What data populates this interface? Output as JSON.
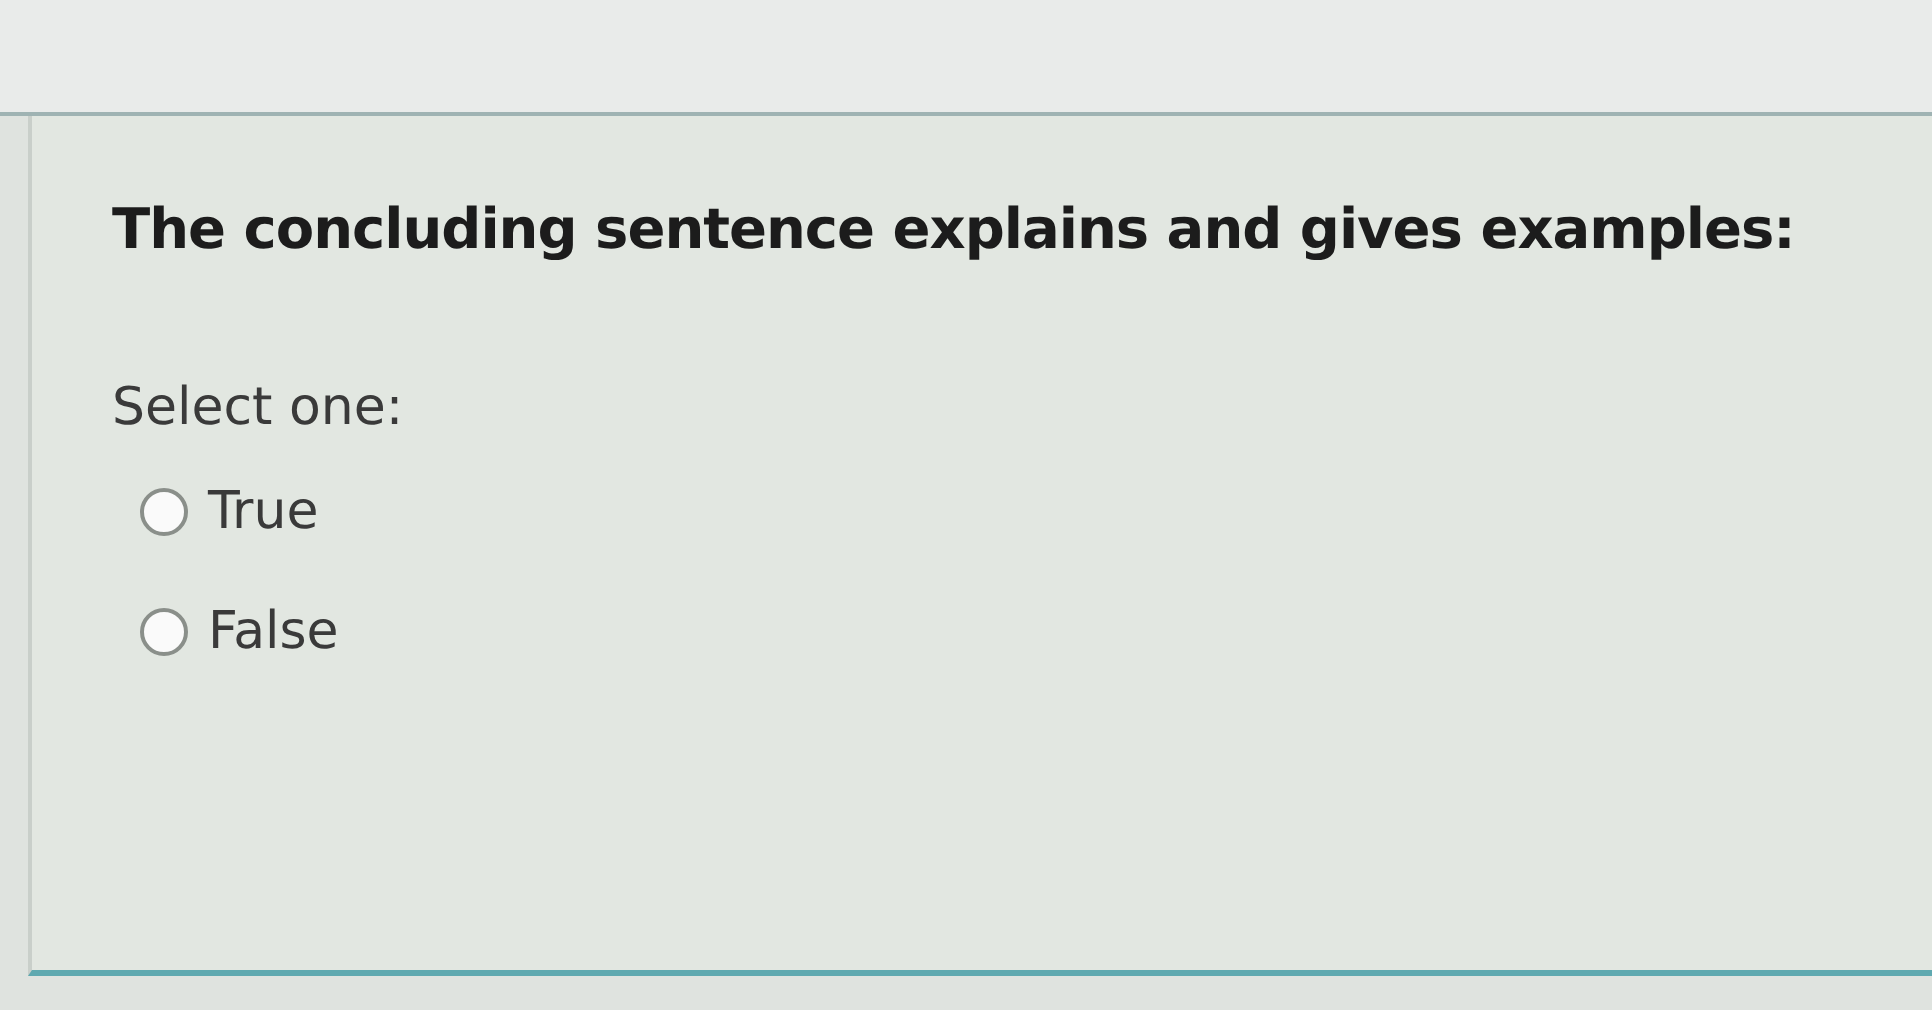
{
  "question": {
    "text": "The concluding sentence explains and gives examples:"
  },
  "prompt": "Select one:",
  "options": [
    {
      "label": "True",
      "selected": false
    },
    {
      "label": "False",
      "selected": false
    }
  ]
}
